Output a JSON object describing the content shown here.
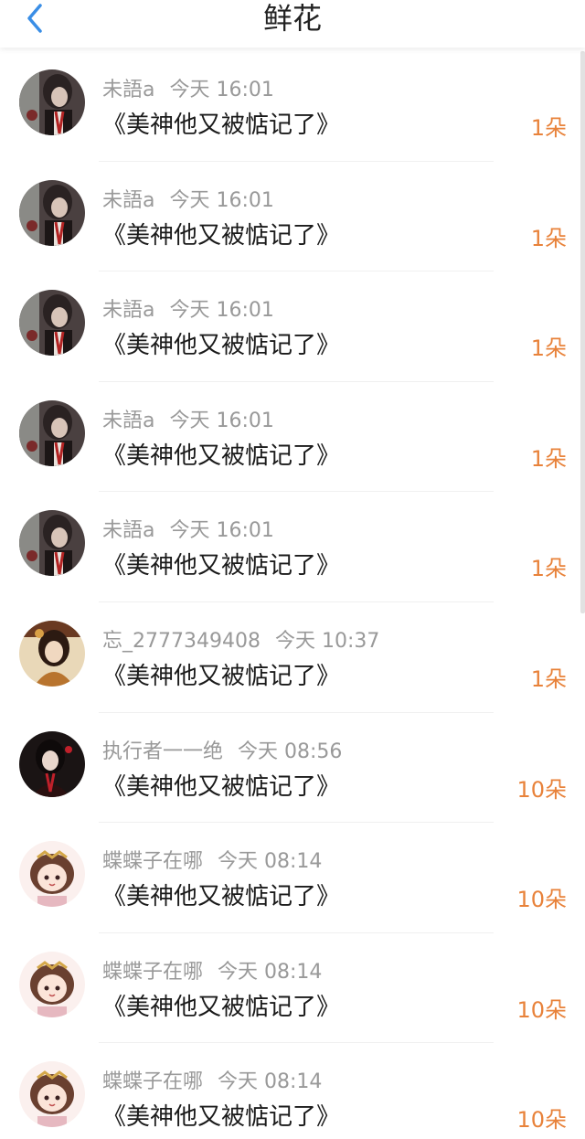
{
  "header": {
    "title": "鲜花",
    "back_icon": "chevron-left-icon",
    "accent_color": "#3a8ee6"
  },
  "colors": {
    "count": "#e8823a",
    "meta": "#999999"
  },
  "items": [
    {
      "user": "未語a",
      "time": "今天 16:01",
      "book": "《美神他又被惦记了》",
      "count": "1朵",
      "avatar": "dark-portrait-avatar"
    },
    {
      "user": "未語a",
      "time": "今天 16:01",
      "book": "《美神他又被惦记了》",
      "count": "1朵",
      "avatar": "dark-portrait-avatar"
    },
    {
      "user": "未語a",
      "time": "今天 16:01",
      "book": "《美神他又被惦记了》",
      "count": "1朵",
      "avatar": "dark-portrait-avatar"
    },
    {
      "user": "未語a",
      "time": "今天 16:01",
      "book": "《美神他又被惦记了》",
      "count": "1朵",
      "avatar": "dark-portrait-avatar"
    },
    {
      "user": "未語a",
      "time": "今天 16:01",
      "book": "《美神他又被惦记了》",
      "count": "1朵",
      "avatar": "dark-portrait-avatar"
    },
    {
      "user": "忘_2777349408",
      "time": "今天 10:37",
      "book": "《美神他又被惦记了》",
      "count": "1朵",
      "avatar": "warm-portrait-avatar"
    },
    {
      "user": "执行者一一绝",
      "time": "今天 08:56",
      "book": "《美神他又被惦记了》",
      "count": "10朵",
      "avatar": "black-red-portrait-avatar"
    },
    {
      "user": "蝶蝶子在哪",
      "time": "今天 08:14",
      "book": "《美神他又被惦记了》",
      "count": "10朵",
      "avatar": "chibi-girl-avatar"
    },
    {
      "user": "蝶蝶子在哪",
      "time": "今天 08:14",
      "book": "《美神他又被惦记了》",
      "count": "10朵",
      "avatar": "chibi-girl-avatar"
    },
    {
      "user": "蝶蝶子在哪",
      "time": "今天 08:14",
      "book": "《美神他又被惦记了》",
      "count": "10朵",
      "avatar": "chibi-girl-avatar"
    }
  ]
}
